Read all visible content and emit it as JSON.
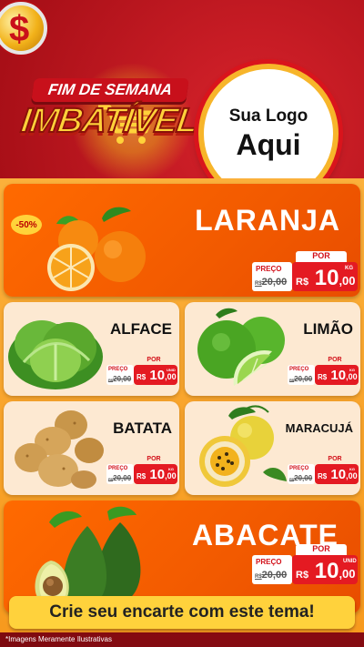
{
  "header": {
    "coin_symbol": "$",
    "title_line1": "FIM DE SEMANA",
    "title_line2": "IMBATÍVEL",
    "logo_line1": "Sua Logo",
    "logo_line2": "Aqui"
  },
  "products": [
    {
      "name": "LARANJA",
      "badge": "-50%",
      "por": "POR",
      "preco": "PREÇO",
      "old_label": "R$",
      "old_price": "20,00",
      "currency": "R$",
      "price_int": "10",
      "price_dec": ",00",
      "unit": "KG"
    },
    {
      "name": "ALFACE",
      "por": "POR",
      "preco": "PREÇO",
      "old_label": "R$",
      "old_price": "20,00",
      "currency": "R$",
      "price_int": "10",
      "price_dec": ",00",
      "unit": "UNID"
    },
    {
      "name": "LIMÃO",
      "por": "POR",
      "preco": "PREÇO",
      "old_label": "R$",
      "old_price": "20,00",
      "currency": "R$",
      "price_int": "10",
      "price_dec": ",00",
      "unit": "KG"
    },
    {
      "name": "BATATA",
      "por": "POR",
      "preco": "PREÇO",
      "old_label": "R$",
      "old_price": "20,00",
      "currency": "R$",
      "price_int": "10",
      "price_dec": ",00",
      "unit": "KG"
    },
    {
      "name": "MARACUJÁ",
      "por": "POR",
      "preco": "PREÇO",
      "old_label": "R$",
      "old_price": "20,00",
      "currency": "R$",
      "price_int": "10",
      "price_dec": ",00",
      "unit": "KG"
    },
    {
      "name": "ABACATE",
      "por": "POR",
      "preco": "PREÇO",
      "old_label": "R$",
      "old_price": "20,00",
      "currency": "R$",
      "price_int": "10",
      "price_dec": ",00",
      "unit": "UNID"
    }
  ],
  "footer": {
    "cta": "Crie seu encarte com este tema!",
    "disclaimer": "*Imagens Meramente Ilustrativas"
  },
  "colors": {
    "background_red": "#a80f17",
    "panel_orange": "#f79a1e",
    "card_orange": "#f25a00",
    "card_cream": "#fde9d2",
    "price_red": "#e41a22",
    "cta_yellow": "#ffd23c"
  }
}
